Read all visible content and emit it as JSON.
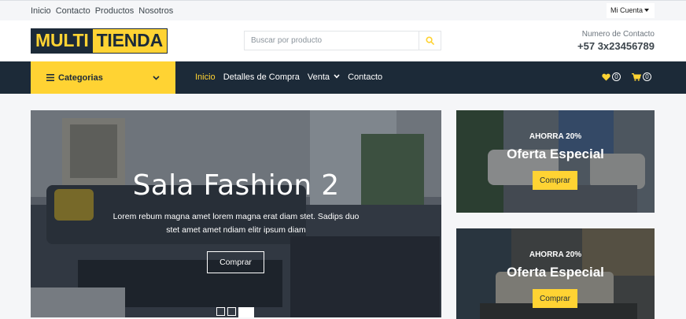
{
  "topbar": {
    "links": [
      "Inicio",
      "Contacto",
      "Productos",
      "Nosotros"
    ],
    "account_label": "Mi Cuenta"
  },
  "header": {
    "logo_part1": "MULTI",
    "logo_part2": "TIENDA",
    "search_placeholder": "Buscar por producto",
    "contact_label": "Numero de Contacto",
    "contact_number": "+57 3x23456789"
  },
  "navbar": {
    "categories_label": "Categorias",
    "links": [
      {
        "label": "Inicio",
        "active": true
      },
      {
        "label": "Detalles de Compra"
      },
      {
        "label": "Venta"
      },
      {
        "label": "Contacto"
      }
    ],
    "wishlist_count": "0",
    "cart_count": "0"
  },
  "hero": {
    "title": "Sala Fashion 2",
    "description": "Lorem rebum magna amet lorem magna erat diam stet. Sadips duo stet amet amet ndiam elitr ipsum diam",
    "button": "Comprar",
    "slides": 3,
    "active_slide": 3
  },
  "offers": [
    {
      "save": "AHORRA 20%",
      "title": "Oferta Especial",
      "button": "Comprar"
    },
    {
      "save": "AHORRA 20%",
      "title": "Oferta Especial",
      "button": "Comprar"
    }
  ],
  "colors": {
    "accent": "#ffd333",
    "dark": "#1c2a38",
    "background": "#f5f6f8"
  },
  "icons": {
    "search": "search-icon",
    "bars": "bars-icon",
    "chevron": "chevron-down-icon",
    "heart": "heart-icon",
    "cart": "cart-icon"
  }
}
